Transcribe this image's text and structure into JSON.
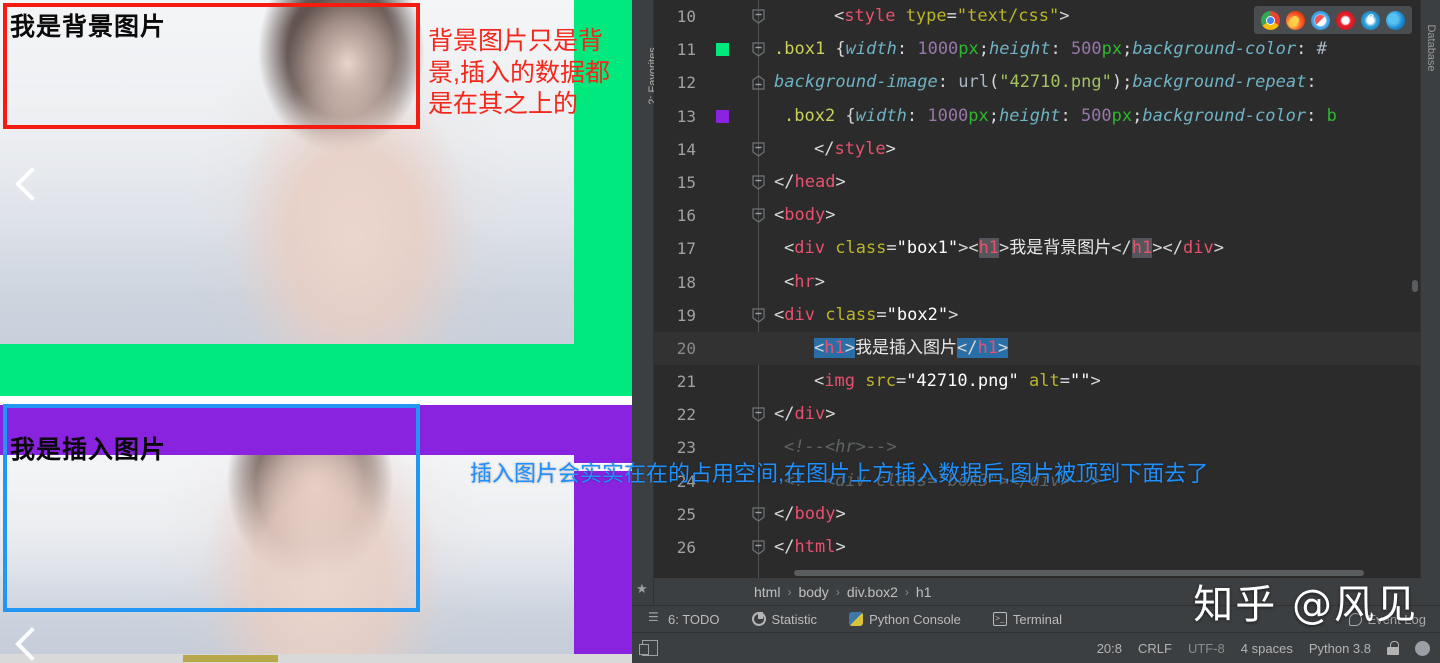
{
  "preview": {
    "box1_heading": "我是背景图片",
    "box2_heading": "我是插入图片",
    "red_annotation": "背景图片只是背景,插入的数据都是在其之上的",
    "blue_annotation": "插入图片会实实在在的占用空间,在图片上方插入数据后,图片被顶到下面去了",
    "nav_prev_icon": "chevron-left-icon",
    "colors": {
      "red_outline": "#f41b10",
      "blue_outline": "#2196f3",
      "green_band": "#00e97e",
      "purple_band": "#8a23e0",
      "red_text": "#f4271a",
      "blue_text": "#1e90ff"
    }
  },
  "ide": {
    "left_rail_label": "2: Favorites",
    "right_rail_label": "Database",
    "breadcrumb": [
      "html",
      "body",
      "div.box2",
      "h1"
    ],
    "browser_icons": [
      "chrome-icon",
      "firefox-icon",
      "safari-icon",
      "opera-icon",
      "internet-explorer-icon",
      "edge-icon"
    ],
    "code_lines": [
      {
        "num": "10",
        "indent": 6,
        "fold": "collapse",
        "swatch": null,
        "tokens": [
          {
            "t": "<",
            "c": "t-punct"
          },
          {
            "t": "style",
            "c": "t-tag"
          },
          {
            "t": " ",
            "c": "t-punct"
          },
          {
            "t": "type",
            "c": "t-attr"
          },
          {
            "t": "=",
            "c": "t-punct"
          },
          {
            "t": "\"text/css\"",
            "c": "t-attr"
          },
          {
            "t": ">",
            "c": "t-punct"
          }
        ]
      },
      {
        "num": "11",
        "indent": 0,
        "fold": "collapse",
        "swatch": "#00e97e",
        "tokens": [
          {
            "t": ".box1 ",
            "c": "t-sel"
          },
          {
            "t": "{",
            "c": "t-punct"
          },
          {
            "t": "width",
            "c": "t-prop"
          },
          {
            "t": ": ",
            "c": "t-punct"
          },
          {
            "t": "1000",
            "c": "t-num"
          },
          {
            "t": "px",
            "c": "t-unit"
          },
          {
            "t": ";",
            "c": "t-punct"
          },
          {
            "t": "height",
            "c": "t-prop"
          },
          {
            "t": ": ",
            "c": "t-punct"
          },
          {
            "t": "500",
            "c": "t-num"
          },
          {
            "t": "px",
            "c": "t-unit"
          },
          {
            "t": ";",
            "c": "t-punct"
          },
          {
            "t": "background-color",
            "c": "t-prop"
          },
          {
            "t": ": ",
            "c": "t-punct"
          },
          {
            "t": "#",
            "c": "t-val"
          }
        ]
      },
      {
        "num": "12",
        "indent": 0,
        "fold": "expand",
        "swatch": null,
        "tokens": [
          {
            "t": "background-image",
            "c": "t-prop"
          },
          {
            "t": ": ",
            "c": "t-punct"
          },
          {
            "t": "url",
            "c": "t-val"
          },
          {
            "t": "(",
            "c": "t-punct"
          },
          {
            "t": "\"42710.png\"",
            "c": "t-str"
          },
          {
            "t": ")",
            "c": "t-punct"
          },
          {
            "t": ";",
            "c": "t-punct"
          },
          {
            "t": "background-repeat",
            "c": "t-prop"
          },
          {
            "t": ":",
            "c": "t-punct"
          }
        ]
      },
      {
        "num": "13",
        "indent": 1,
        "fold": null,
        "swatch": "#8a23e0",
        "tokens": [
          {
            "t": ".box2 ",
            "c": "t-sel"
          },
          {
            "t": "{",
            "c": "t-punct"
          },
          {
            "t": "width",
            "c": "t-prop"
          },
          {
            "t": ": ",
            "c": "t-punct"
          },
          {
            "t": "1000",
            "c": "t-num"
          },
          {
            "t": "px",
            "c": "t-unit"
          },
          {
            "t": ";",
            "c": "t-punct"
          },
          {
            "t": "height",
            "c": "t-prop"
          },
          {
            "t": ": ",
            "c": "t-punct"
          },
          {
            "t": "500",
            "c": "t-num"
          },
          {
            "t": "px",
            "c": "t-unit"
          },
          {
            "t": ";",
            "c": "t-punct"
          },
          {
            "t": "background-color",
            "c": "t-prop"
          },
          {
            "t": ": ",
            "c": "t-punct"
          },
          {
            "t": "b",
            "c": "t-unit"
          }
        ]
      },
      {
        "num": "14",
        "indent": 4,
        "fold": "collapse",
        "swatch": null,
        "tokens": [
          {
            "t": "</",
            "c": "t-punct"
          },
          {
            "t": "style",
            "c": "t-tag"
          },
          {
            "t": ">",
            "c": "t-punct"
          }
        ]
      },
      {
        "num": "15",
        "indent": 0,
        "fold": "collapse",
        "swatch": null,
        "tokens": [
          {
            "t": "</",
            "c": "t-punct"
          },
          {
            "t": "head",
            "c": "t-tag"
          },
          {
            "t": ">",
            "c": "t-punct"
          }
        ]
      },
      {
        "num": "16",
        "indent": 0,
        "fold": "collapse",
        "swatch": null,
        "tokens": [
          {
            "t": "<",
            "c": "t-punct"
          },
          {
            "t": "body",
            "c": "t-tag"
          },
          {
            "t": ">",
            "c": "t-punct"
          }
        ]
      },
      {
        "num": "17",
        "indent": 1,
        "fold": null,
        "swatch": null,
        "tokens": [
          {
            "t": "<",
            "c": "t-punct"
          },
          {
            "t": "div",
            "c": "t-tag"
          },
          {
            "t": " ",
            "c": "t-punct"
          },
          {
            "t": "class",
            "c": "t-attr"
          },
          {
            "t": "=",
            "c": "t-punct"
          },
          {
            "t": "\"box1\"",
            "c": "t-white"
          },
          {
            "t": "><",
            "c": "t-punct"
          },
          {
            "t": "h1",
            "c": "t-tag hl-tagname"
          },
          {
            "t": ">",
            "c": "t-punct"
          },
          {
            "t": "我是背景图片",
            "c": "t-text"
          },
          {
            "t": "</",
            "c": "t-punct"
          },
          {
            "t": "h1",
            "c": "t-tag hl-tagname"
          },
          {
            "t": "></",
            "c": "t-punct"
          },
          {
            "t": "div",
            "c": "t-tag"
          },
          {
            "t": ">",
            "c": "t-punct"
          }
        ]
      },
      {
        "num": "18",
        "indent": 1,
        "fold": null,
        "swatch": null,
        "tokens": [
          {
            "t": "<",
            "c": "t-punct"
          },
          {
            "t": "hr",
            "c": "t-tag"
          },
          {
            "t": ">",
            "c": "t-punct"
          }
        ]
      },
      {
        "num": "19",
        "indent": 0,
        "fold": "collapse",
        "swatch": null,
        "tokens": [
          {
            "t": "<",
            "c": "t-punct"
          },
          {
            "t": "div",
            "c": "t-tag"
          },
          {
            "t": " ",
            "c": "t-punct"
          },
          {
            "t": "class",
            "c": "t-attr"
          },
          {
            "t": "=",
            "c": "t-punct"
          },
          {
            "t": "\"box2\"",
            "c": "t-white"
          },
          {
            "t": ">",
            "c": "t-punct"
          }
        ]
      },
      {
        "num": "20",
        "indent": 4,
        "fold": null,
        "swatch": null,
        "current": true,
        "tokens": [
          {
            "t": "<",
            "c": "t-punct sel"
          },
          {
            "t": "h1",
            "c": "t-tag sel"
          },
          {
            "t": ">",
            "c": "t-punct sel"
          },
          {
            "t": "我是插入图片",
            "c": "t-text"
          },
          {
            "t": "</",
            "c": "t-punct sel"
          },
          {
            "t": "h1",
            "c": "t-tag sel"
          },
          {
            "t": ">",
            "c": "t-punct sel"
          }
        ]
      },
      {
        "num": "21",
        "indent": 4,
        "fold": null,
        "swatch": null,
        "tokens": [
          {
            "t": "<",
            "c": "t-punct"
          },
          {
            "t": "img",
            "c": "t-tag"
          },
          {
            "t": " ",
            "c": "t-punct"
          },
          {
            "t": "src",
            "c": "t-attr"
          },
          {
            "t": "=",
            "c": "t-punct"
          },
          {
            "t": "\"42710.png\"",
            "c": "t-white"
          },
          {
            "t": " ",
            "c": "t-punct"
          },
          {
            "t": "alt",
            "c": "t-attr"
          },
          {
            "t": "=",
            "c": "t-punct"
          },
          {
            "t": "\"\"",
            "c": "t-white"
          },
          {
            "t": ">",
            "c": "t-punct"
          }
        ]
      },
      {
        "num": "22",
        "indent": 0,
        "fold": "collapse",
        "swatch": null,
        "tokens": [
          {
            "t": "</",
            "c": "t-punct"
          },
          {
            "t": "div",
            "c": "t-tag"
          },
          {
            "t": ">",
            "c": "t-punct"
          }
        ]
      },
      {
        "num": "23",
        "indent": 1,
        "fold": null,
        "swatch": null,
        "tokens": [
          {
            "t": "<!--<hr>-->",
            "c": "t-comment"
          }
        ]
      },
      {
        "num": "24",
        "indent": 1,
        "fold": null,
        "swatch": null,
        "tokens": [
          {
            "t": "<!--<div class=\"box3\"></div>-->",
            "c": "t-comment"
          }
        ]
      },
      {
        "num": "25",
        "indent": 0,
        "fold": "collapse",
        "swatch": null,
        "tokens": [
          {
            "t": "</",
            "c": "t-punct"
          },
          {
            "t": "body",
            "c": "t-tag"
          },
          {
            "t": ">",
            "c": "t-punct"
          }
        ]
      },
      {
        "num": "26",
        "indent": 0,
        "fold": "collapse",
        "swatch": null,
        "tokens": [
          {
            "t": "</",
            "c": "t-punct"
          },
          {
            "t": "html",
            "c": "t-tag"
          },
          {
            "t": ">",
            "c": "t-punct"
          }
        ]
      }
    ],
    "tool_tabs": [
      {
        "label": "6: TODO",
        "icon": "todo-icon"
      },
      {
        "label": "Statistic",
        "icon": "statistic-icon"
      },
      {
        "label": "Python Console",
        "icon": "python-icon"
      },
      {
        "label": "Terminal",
        "icon": "terminal-icon"
      }
    ],
    "event_log": {
      "label": "Event Log",
      "icon": "event-log-icon"
    },
    "status": {
      "caret": "20:8",
      "line_separator": "CRLF",
      "encoding": "UTF-8",
      "indent": "4 spaces",
      "interpreter": "Python 3.8",
      "lock_icon": "lock-icon",
      "account_icon": "person-icon"
    }
  },
  "watermark": "知乎 @风见"
}
